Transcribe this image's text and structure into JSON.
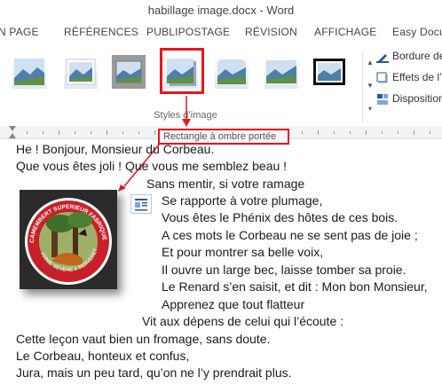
{
  "window": {
    "title": "habillage image.docx - Word"
  },
  "tabs": [
    "N PAGE",
    "RÉFÉRENCES",
    "PUBLIPOSTAGE",
    "RÉVISION",
    "AFFICHAGE",
    "Easy Docu"
  ],
  "ribbon": {
    "group_label": "Styles d’image",
    "commands": [
      "Bordure de",
      "Effets de l’",
      "Disposition"
    ]
  },
  "tooltip": {
    "text": "Rectangle à ombre portée"
  },
  "document": {
    "lines": [
      "He ! Bonjour, Monsieur du Corbeau.",
      "Que vous êtes joli !  Que vous me semblez beau !",
      "Sans mentir, si votre ramage",
      "Se rapporte à votre plumage,",
      "Vous êtes le Phénix des hôtes de ces bois.",
      "A ces mots le Corbeau ne se sent pas de joie ;",
      "Et pour montrer sa belle voix,",
      "Il ouvre un large bec, laisse tomber sa proie.",
      "Le Renard s’en saisit, et dit : Mon bon Monsieur,",
      "Apprenez que tout flatteur",
      "Vit aux dépens de celui qui l’écoute :",
      "Cette leçon vaut bien un fromage, sans doute.",
      "Le Corbeau, honteux et confus,",
      "Jura, mais un peu tard, qu’on ne l’y prendrait plus."
    ]
  },
  "picture": {
    "label_top": "CAMEMBERT SUPERIEUR FABRIQUE EN LORRAINE",
    "label_bottom": "ANNIE SEVENE à SERVERETTE"
  },
  "colors": {
    "highlight": "#e8151a",
    "word_blue": "#2b579a"
  }
}
